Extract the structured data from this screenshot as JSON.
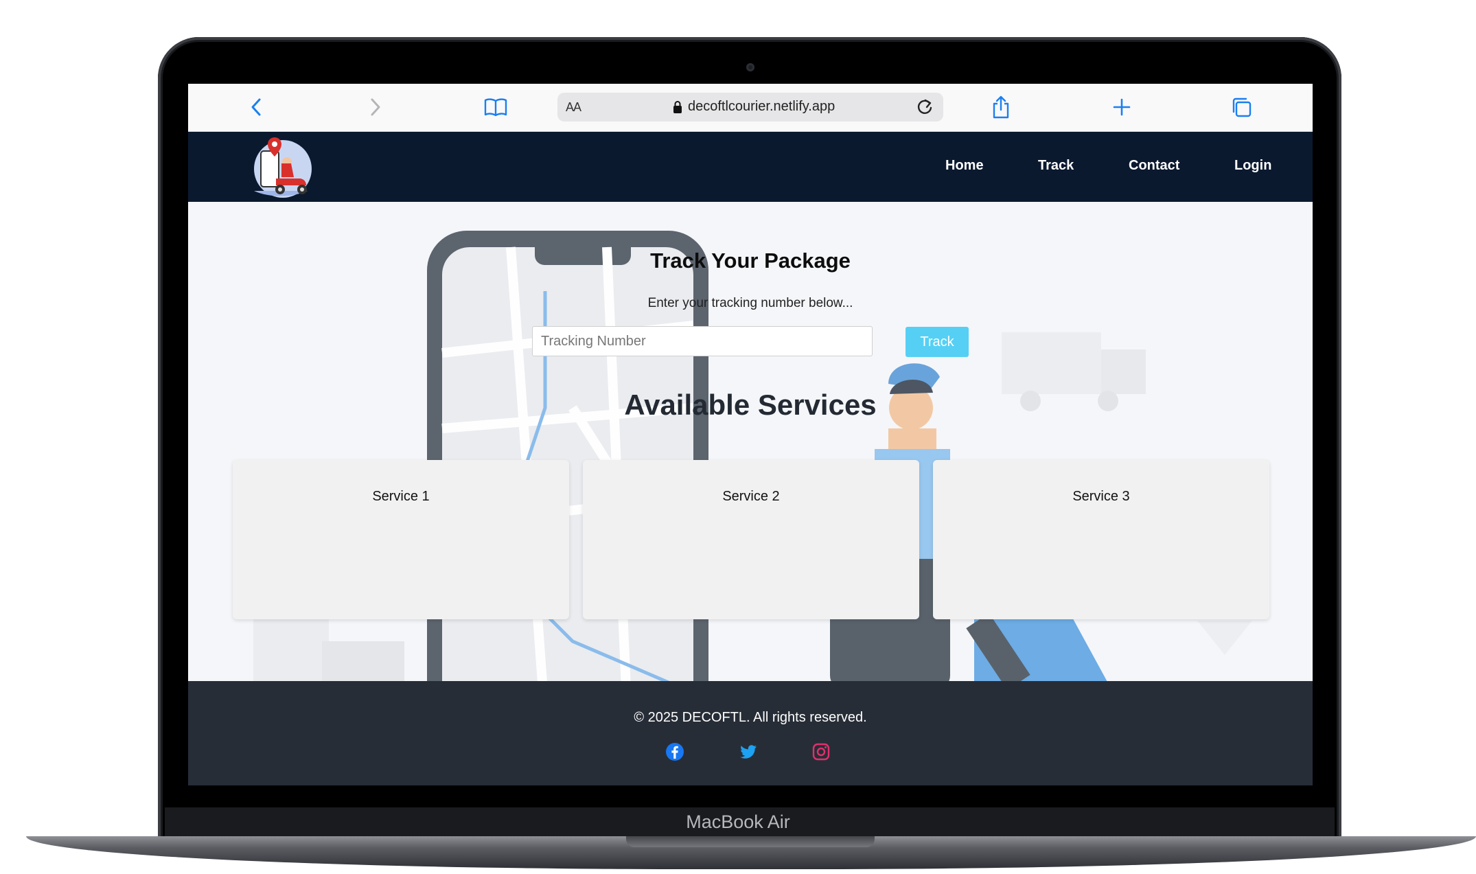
{
  "device": {
    "label": "MacBook Air"
  },
  "browser": {
    "text_size_label": "AA",
    "url": "decoftlcourier.netlify.app"
  },
  "nav": {
    "links": [
      "Home",
      "Track",
      "Contact",
      "Login"
    ]
  },
  "hero": {
    "title": "Track Your Package",
    "subtitle": "Enter your tracking number below...",
    "input_placeholder": "Tracking Number",
    "track_button": "Track"
  },
  "services": {
    "title": "Available Services",
    "items": [
      "Service 1",
      "Service 2",
      "Service 3"
    ]
  },
  "footer": {
    "copyright": "© 2025 DECOFTL. All rights reserved.",
    "social": [
      {
        "icon": "facebook-icon",
        "color": "#1877f2"
      },
      {
        "icon": "twitter-icon",
        "color": "#1da1f2"
      },
      {
        "icon": "instagram-icon",
        "color": "#e1306c"
      }
    ]
  },
  "colors": {
    "nav_bg": "#0b192f",
    "track_button": "#55d0f4",
    "footer_bg": "#272d37",
    "browser_accent": "#1a7ff0"
  }
}
